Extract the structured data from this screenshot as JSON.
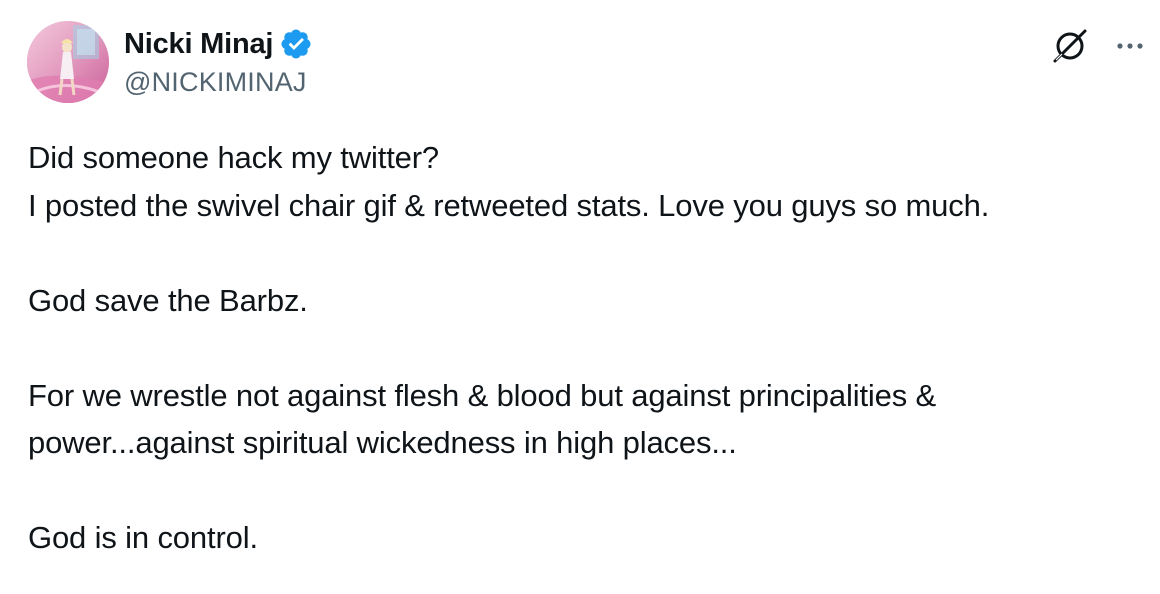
{
  "tweet": {
    "author": {
      "display_name": "Nicki Minaj",
      "handle": "@NICKIMINAJ",
      "verified": true,
      "verified_badge_color": "#1d9bf0"
    },
    "icons": {
      "grok": "grok-icon",
      "more": "more-options-icon"
    },
    "text_lines": [
      "Did someone hack my twitter?",
      "I posted the swivel chair gif & retweeted stats. Love you guys so much.",
      "",
      "God save the Barbz.",
      "",
      "For we wrestle not against flesh & blood but against principalities &",
      "power...against spiritual wickedness in high places...",
      "",
      "God is in control."
    ]
  },
  "colors": {
    "text_primary": "#0f1419",
    "text_secondary": "#536471",
    "background": "#ffffff",
    "avatar_pink": "#d98cb3"
  }
}
